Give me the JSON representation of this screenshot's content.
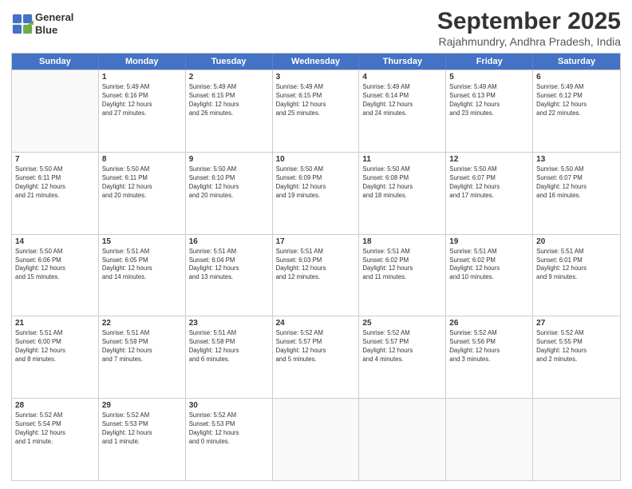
{
  "logo": {
    "line1": "General",
    "line2": "Blue"
  },
  "title": "September 2025",
  "subtitle": "Rajahmundry, Andhra Pradesh, India",
  "header_days": [
    "Sunday",
    "Monday",
    "Tuesday",
    "Wednesday",
    "Thursday",
    "Friday",
    "Saturday"
  ],
  "weeks": [
    [
      {
        "day": "",
        "info": ""
      },
      {
        "day": "1",
        "info": "Sunrise: 5:49 AM\nSunset: 6:16 PM\nDaylight: 12 hours\nand 27 minutes."
      },
      {
        "day": "2",
        "info": "Sunrise: 5:49 AM\nSunset: 6:15 PM\nDaylight: 12 hours\nand 26 minutes."
      },
      {
        "day": "3",
        "info": "Sunrise: 5:49 AM\nSunset: 6:15 PM\nDaylight: 12 hours\nand 25 minutes."
      },
      {
        "day": "4",
        "info": "Sunrise: 5:49 AM\nSunset: 6:14 PM\nDaylight: 12 hours\nand 24 minutes."
      },
      {
        "day": "5",
        "info": "Sunrise: 5:49 AM\nSunset: 6:13 PM\nDaylight: 12 hours\nand 23 minutes."
      },
      {
        "day": "6",
        "info": "Sunrise: 5:49 AM\nSunset: 6:12 PM\nDaylight: 12 hours\nand 22 minutes."
      }
    ],
    [
      {
        "day": "7",
        "info": "Sunrise: 5:50 AM\nSunset: 6:11 PM\nDaylight: 12 hours\nand 21 minutes."
      },
      {
        "day": "8",
        "info": "Sunrise: 5:50 AM\nSunset: 6:11 PM\nDaylight: 12 hours\nand 20 minutes."
      },
      {
        "day": "9",
        "info": "Sunrise: 5:50 AM\nSunset: 6:10 PM\nDaylight: 12 hours\nand 20 minutes."
      },
      {
        "day": "10",
        "info": "Sunrise: 5:50 AM\nSunset: 6:09 PM\nDaylight: 12 hours\nand 19 minutes."
      },
      {
        "day": "11",
        "info": "Sunrise: 5:50 AM\nSunset: 6:08 PM\nDaylight: 12 hours\nand 18 minutes."
      },
      {
        "day": "12",
        "info": "Sunrise: 5:50 AM\nSunset: 6:07 PM\nDaylight: 12 hours\nand 17 minutes."
      },
      {
        "day": "13",
        "info": "Sunrise: 5:50 AM\nSunset: 6:07 PM\nDaylight: 12 hours\nand 16 minutes."
      }
    ],
    [
      {
        "day": "14",
        "info": "Sunrise: 5:50 AM\nSunset: 6:06 PM\nDaylight: 12 hours\nand 15 minutes."
      },
      {
        "day": "15",
        "info": "Sunrise: 5:51 AM\nSunset: 6:05 PM\nDaylight: 12 hours\nand 14 minutes."
      },
      {
        "day": "16",
        "info": "Sunrise: 5:51 AM\nSunset: 6:04 PM\nDaylight: 12 hours\nand 13 minutes."
      },
      {
        "day": "17",
        "info": "Sunrise: 5:51 AM\nSunset: 6:03 PM\nDaylight: 12 hours\nand 12 minutes."
      },
      {
        "day": "18",
        "info": "Sunrise: 5:51 AM\nSunset: 6:02 PM\nDaylight: 12 hours\nand 11 minutes."
      },
      {
        "day": "19",
        "info": "Sunrise: 5:51 AM\nSunset: 6:02 PM\nDaylight: 12 hours\nand 10 minutes."
      },
      {
        "day": "20",
        "info": "Sunrise: 5:51 AM\nSunset: 6:01 PM\nDaylight: 12 hours\nand 9 minutes."
      }
    ],
    [
      {
        "day": "21",
        "info": "Sunrise: 5:51 AM\nSunset: 6:00 PM\nDaylight: 12 hours\nand 8 minutes."
      },
      {
        "day": "22",
        "info": "Sunrise: 5:51 AM\nSunset: 5:59 PM\nDaylight: 12 hours\nand 7 minutes."
      },
      {
        "day": "23",
        "info": "Sunrise: 5:51 AM\nSunset: 5:58 PM\nDaylight: 12 hours\nand 6 minutes."
      },
      {
        "day": "24",
        "info": "Sunrise: 5:52 AM\nSunset: 5:57 PM\nDaylight: 12 hours\nand 5 minutes."
      },
      {
        "day": "25",
        "info": "Sunrise: 5:52 AM\nSunset: 5:57 PM\nDaylight: 12 hours\nand 4 minutes."
      },
      {
        "day": "26",
        "info": "Sunrise: 5:52 AM\nSunset: 5:56 PM\nDaylight: 12 hours\nand 3 minutes."
      },
      {
        "day": "27",
        "info": "Sunrise: 5:52 AM\nSunset: 5:55 PM\nDaylight: 12 hours\nand 2 minutes."
      }
    ],
    [
      {
        "day": "28",
        "info": "Sunrise: 5:52 AM\nSunset: 5:54 PM\nDaylight: 12 hours\nand 1 minute."
      },
      {
        "day": "29",
        "info": "Sunrise: 5:52 AM\nSunset: 5:53 PM\nDaylight: 12 hours\nand 1 minute."
      },
      {
        "day": "30",
        "info": "Sunrise: 5:52 AM\nSunset: 5:53 PM\nDaylight: 12 hours\nand 0 minutes."
      },
      {
        "day": "",
        "info": ""
      },
      {
        "day": "",
        "info": ""
      },
      {
        "day": "",
        "info": ""
      },
      {
        "day": "",
        "info": ""
      }
    ]
  ]
}
